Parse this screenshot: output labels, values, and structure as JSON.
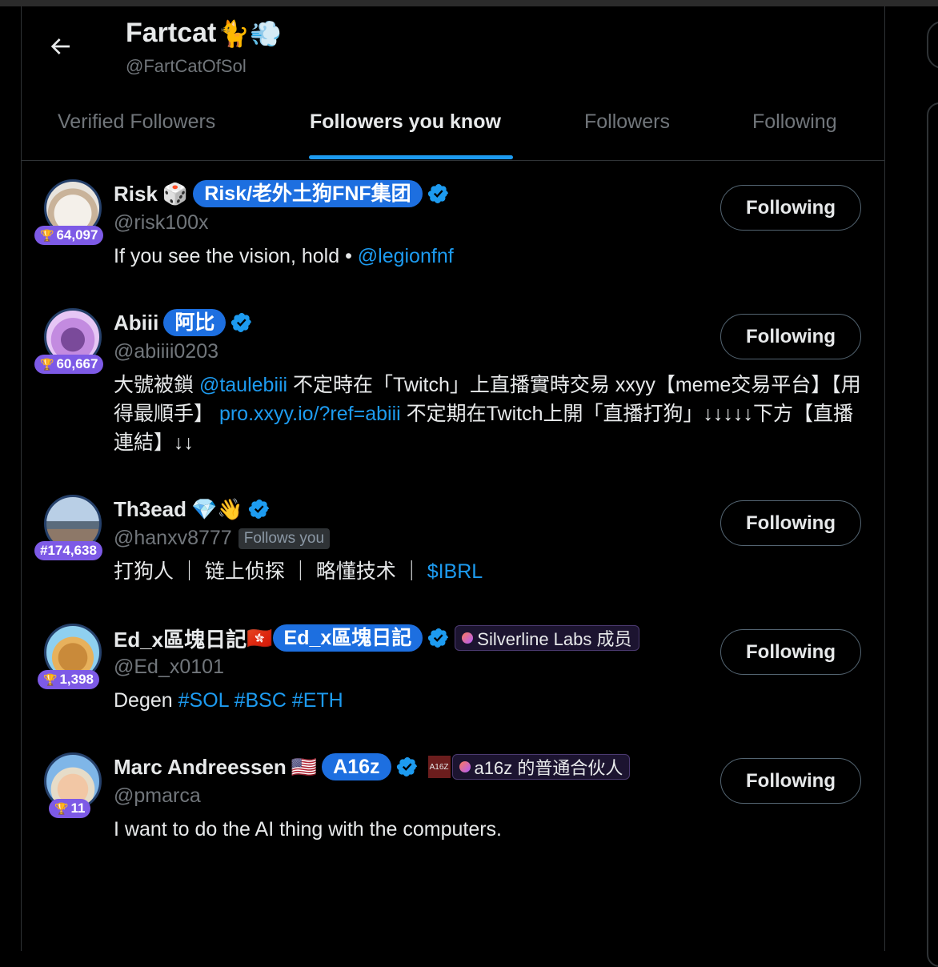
{
  "header": {
    "title": "Fartcat",
    "title_emoji": "🐈💨",
    "handle": "@FartCatOfSol"
  },
  "tabs": [
    {
      "label": "Verified Followers",
      "active": false
    },
    {
      "label": "Followers you know",
      "active": true
    },
    {
      "label": "Followers",
      "active": false
    },
    {
      "label": "Following",
      "active": false
    }
  ],
  "colors": {
    "accent": "#1d9bf0",
    "rank_badge": "#7d5ae6",
    "background": "#000000"
  },
  "users": [
    {
      "name": "Risk",
      "name_emoji": "🎲",
      "pill": "Risk/老外土狗FNF集团",
      "handle": "@risk100x",
      "rank": "64,097",
      "bio_text": "If you see the vision, hold • ",
      "bio_link": "@legionfnf",
      "button": "Following"
    },
    {
      "name": "Abiii",
      "pill": "阿比",
      "handle": "@abiiii0203",
      "rank": "60,667",
      "bio_1": "大號被鎖 ",
      "bio_link_1": "@taulebiii",
      "bio_2": " 不定時在「Twitch」上直播實時交易 xxyy【meme交易平台】【用得最順手】 ",
      "bio_link_2": "pro.xxyy.io/?ref=abiii",
      "bio_3": " 不定期在Twitch上開「直播打狗」↓↓↓↓↓下方【直播連結】↓↓",
      "button": "Following"
    },
    {
      "name": "Th3ead",
      "name_emoji": "💎👋",
      "handle": "@hanxv8777",
      "follows_you": "Follows you",
      "rank": "#174,638",
      "bio_text": "打狗人 ｜ 链上侦探 ｜ 略懂技术 ｜ ",
      "bio_link": "$IBRL",
      "button": "Following"
    },
    {
      "name": "Ed_x區塊日記",
      "name_emoji": "🇭🇰",
      "pill": "Ed_x區塊日記",
      "affiliation": "Silverline Labs 成员",
      "handle": "@Ed_x0101",
      "rank": "1,398",
      "bio_text": "Degen ",
      "bio_link": "#SOL #BSC #ETH",
      "button": "Following"
    },
    {
      "name": "Marc Andreessen",
      "name_emoji": "🇺🇸",
      "pill": "A16z",
      "affiliation_logo": "A16Z",
      "affiliation": "a16z 的普通合伙人",
      "handle": "@pmarca",
      "rank": "11",
      "bio_text": "I want to do the AI thing with the computers.",
      "button": "Following"
    }
  ]
}
